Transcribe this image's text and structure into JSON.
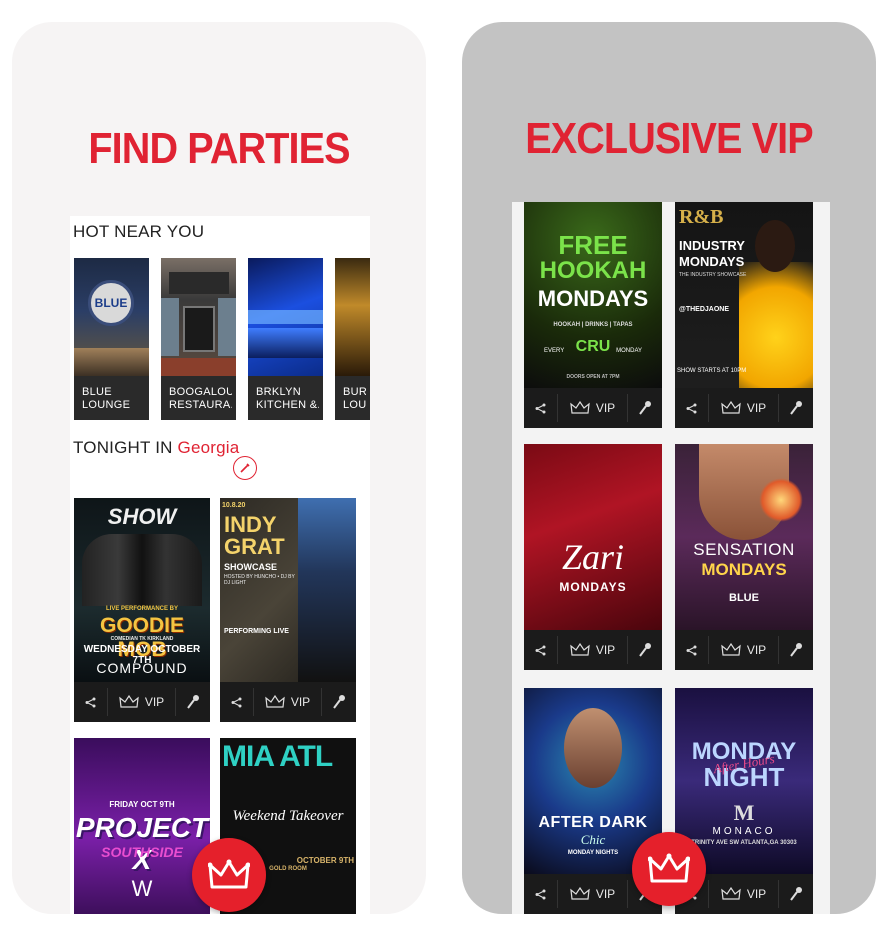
{
  "left_panel": {
    "headline": "FIND PARTIES",
    "hot_near_you": "HOT NEAR YOU",
    "venues": [
      {
        "name": "BLUE LOUNGE",
        "line1": "BLUE",
        "line2": "LOUNGE",
        "sign": "BLUE"
      },
      {
        "name": "BOOGALOU RESTAURANT",
        "line1": "BOOGALOU",
        "line2": "RESTAURA..."
      },
      {
        "name": "BRKLYN KITCHEN",
        "line1": "BRKLYN",
        "line2": "KITCHEN &..."
      },
      {
        "name": "BUR LOU",
        "line1": "BUR",
        "line2": "LOU"
      }
    ],
    "tonight_in": "TONIGHT IN",
    "location": "Georgia",
    "events": [
      {
        "title_top": "SHOW",
        "title": "GOODIE MOB",
        "sub": "COMEDIAN TK KIRKLAND",
        "date": "WEDNESDAY OCTOBER 7TH",
        "venue": "COMPOUND",
        "live": "LIVE PERFORMANCE BY"
      },
      {
        "date": "10.8.20",
        "title": "INDY GRAT",
        "sub": "SHOWCASE",
        "host": "HOSTED BY HUNCHO • DJ BY DJ LIGHT",
        "perf": "PERFORMING LIVE"
      },
      {
        "date": "FRIDAY OCT 9TH",
        "title": "PROJECT X",
        "sub": "SOUTHSIDE",
        "extra": "W"
      },
      {
        "title": "MIA ATL",
        "sub": "Weekend Takeover",
        "venue": "GOLD ROOM",
        "date": "OCTOBER 9TH"
      }
    ],
    "vip_label": "VIP"
  },
  "right_panel": {
    "headline": "EXCLUSIVE VIP",
    "events": [
      {
        "line1": "FREE",
        "line2": "HOOKAH",
        "line3": "MONDAYS",
        "sub": "HOOKAH | DRINKS | TAPAS",
        "every": "EVERY",
        "brand": "CRU",
        "day": "MONDAY",
        "doors": "DOORS OPEN AT 7PM"
      },
      {
        "line1": "R&B",
        "line2": "INDUSTRY",
        "line3": "MONDAYS",
        "sub": "THE INDUSTRY SHOWCASE",
        "host": "@THEDJAONE",
        "time": "SHOW STARTS AT 10PM"
      },
      {
        "line1": "Zari",
        "line2": "MONDAYS"
      },
      {
        "line1": "SENSATION",
        "line2": "MONDAYS",
        "venue": "BLUE"
      },
      {
        "line1": "AFTER DARK",
        "brand": "Chic",
        "sub": "MONDAY NIGHTS"
      },
      {
        "line1": "MONDAY",
        "line2": "NIGHT",
        "script": "After Hours",
        "venue": "MONACO",
        "address": "TRINITY AVE SW ATLANTA,GA 30303"
      }
    ],
    "vip_label": "VIP"
  },
  "colors": {
    "accent": "#e02333",
    "bar": "#1b1b1b"
  }
}
